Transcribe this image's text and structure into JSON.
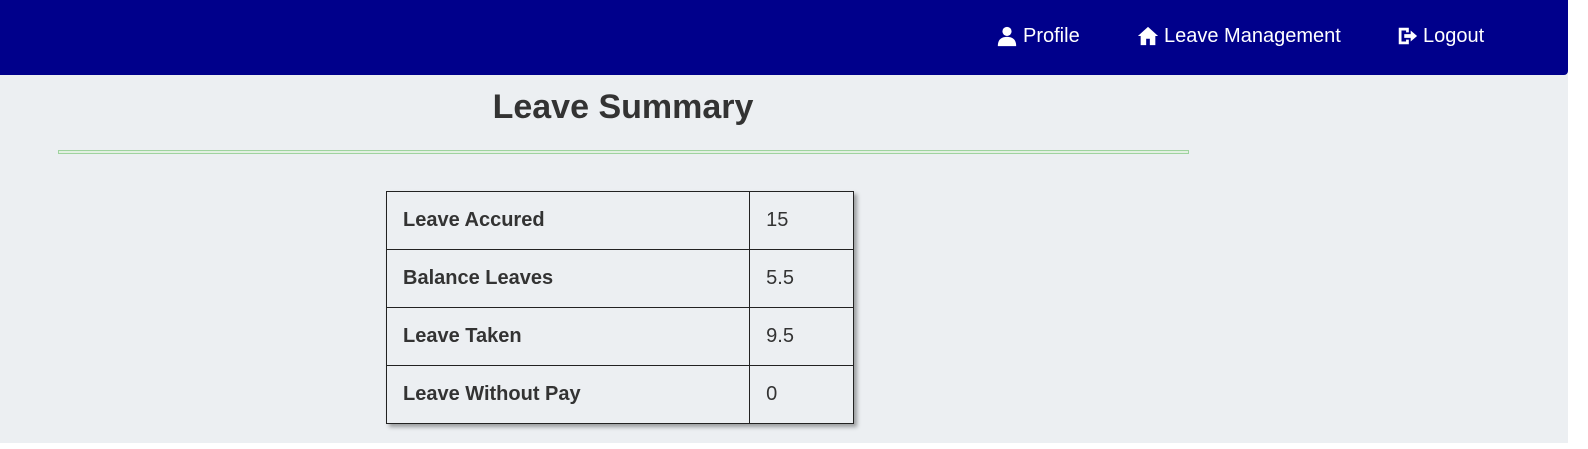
{
  "nav": {
    "profile": {
      "label": "Profile",
      "icon": "user-icon"
    },
    "leave_management": {
      "label": "Leave Management",
      "icon": "home-icon"
    },
    "logout": {
      "label": "Logout",
      "icon": "logout-icon"
    },
    "background": "#00008b"
  },
  "page": {
    "title": "Leave Summary"
  },
  "summary": {
    "rows": [
      {
        "label": "Leave Accured",
        "value": "15"
      },
      {
        "label": "Balance Leaves",
        "value": "5.5"
      },
      {
        "label": "Leave Taken",
        "value": "9.5"
      },
      {
        "label": "Leave Without Pay",
        "value": "0"
      }
    ]
  }
}
